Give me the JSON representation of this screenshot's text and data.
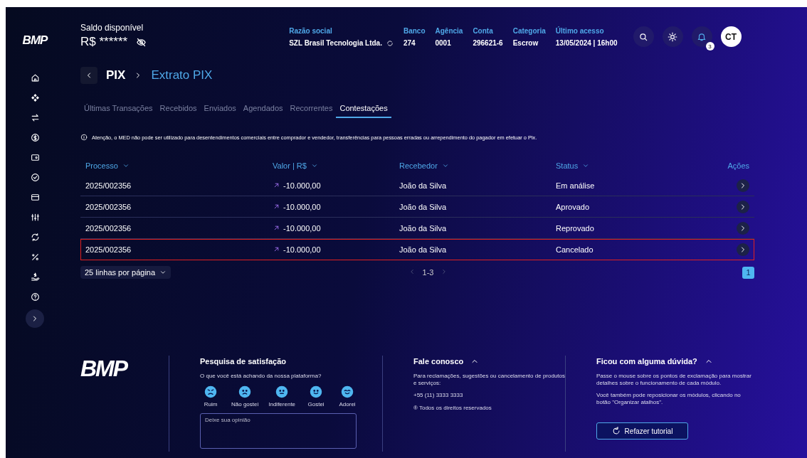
{
  "sidebar": {
    "logo": "BMP",
    "items": [
      {
        "kind": "home"
      },
      {
        "kind": "diamond"
      },
      {
        "kind": "transfer"
      },
      {
        "kind": "dollar"
      },
      {
        "kind": "wallet"
      },
      {
        "kind": "check"
      },
      {
        "kind": "card"
      },
      {
        "kind": "sliders"
      },
      {
        "kind": "refresh"
      },
      {
        "kind": "percent"
      },
      {
        "kind": "hand"
      },
      {
        "kind": "help"
      }
    ]
  },
  "header": {
    "balance_label": "Saldo disponível",
    "balance_value": "R$ ******",
    "info": [
      {
        "label": "Razão social",
        "value": "SZL Brasil Tecnologia Ltda."
      },
      {
        "label": "Banco",
        "value": "274"
      },
      {
        "label": "Agência",
        "value": "0001"
      },
      {
        "label": "Conta",
        "value": "296621-6"
      },
      {
        "label": "Categoria",
        "value": "Escrow"
      },
      {
        "label": "Último acesso",
        "value": "13/05/2024 | 16h00"
      }
    ],
    "notifications_badge": "3",
    "avatar": "CT"
  },
  "breadcrumb": {
    "root": "PIX",
    "current": "Extrato PIX"
  },
  "tabs": [
    {
      "label": "Últimas Transações",
      "selected": false
    },
    {
      "label": "Recebidos",
      "selected": false
    },
    {
      "label": "Enviados",
      "selected": false
    },
    {
      "label": "Agendados",
      "selected": false
    },
    {
      "label": "Recorrentes",
      "selected": false
    },
    {
      "label": "Contestações",
      "selected": true
    }
  ],
  "notice": "Atenção, o MED não pode ser utilizado para desentendimentos comerciais entre comprador e vendedor, transferências para pessoas erradas ou arrependimento do pagador em efetuar o Pix.",
  "table": {
    "columns": [
      {
        "label": "Processo",
        "sortable": true
      },
      {
        "label": "Valor | R$",
        "sortable": true
      },
      {
        "label": "Recebedor",
        "sortable": true
      },
      {
        "label": "Status",
        "sortable": true
      },
      {
        "label": "Ações",
        "sortable": false
      }
    ],
    "rows": [
      {
        "process": "2025/002356",
        "value": "-10.000,00",
        "receiver": "João da Silva",
        "status": "Em análise",
        "highlighted": false
      },
      {
        "process": "2025/002356",
        "value": "-10.000,00",
        "receiver": "João da Silva",
        "status": "Aprovado",
        "highlighted": false
      },
      {
        "process": "2025/002356",
        "value": "-10.000,00",
        "receiver": "João da Silva",
        "status": "Reprovado",
        "highlighted": false
      },
      {
        "process": "2025/002356",
        "value": "-10.000,00",
        "receiver": "João da Silva",
        "status": "Cancelado",
        "highlighted": true
      }
    ]
  },
  "pagination": {
    "rows_per_page": "25 linhas por página",
    "range": "1-3",
    "page": "1"
  },
  "footer": {
    "logo": "BMP",
    "survey": {
      "title": "Pesquisa de satisfação",
      "question": "O que você está achando da nossa plataforma?",
      "options": [
        {
          "label": "Ruim",
          "kind": "angry"
        },
        {
          "label": "Não gostei",
          "kind": "sad"
        },
        {
          "label": "Indiferente",
          "kind": "neutral"
        },
        {
          "label": "Gostei",
          "kind": "smile"
        },
        {
          "label": "Adorei",
          "kind": "love"
        }
      ],
      "placeholder": "Deixe sua opinião"
    },
    "contact": {
      "title": "Fale conosco",
      "text": "Para reclamações, sugestões ou cancelamento de produtos e serviços:",
      "phone": "+55 (11) 3333 3333",
      "rights": "® Todos os direitos reservados"
    },
    "help": {
      "title": "Ficou com alguma dúvida?",
      "paragraphs": [
        "Passe o mouse sobre os pontos de exclamação para mostrar detalhes sobre o funcionamento de cada módulo.",
        "Você também pode reposicionar os módulos, clicando no botão \"Organizar atalhos\"."
      ],
      "button": "Refazer tutorial"
    }
  }
}
